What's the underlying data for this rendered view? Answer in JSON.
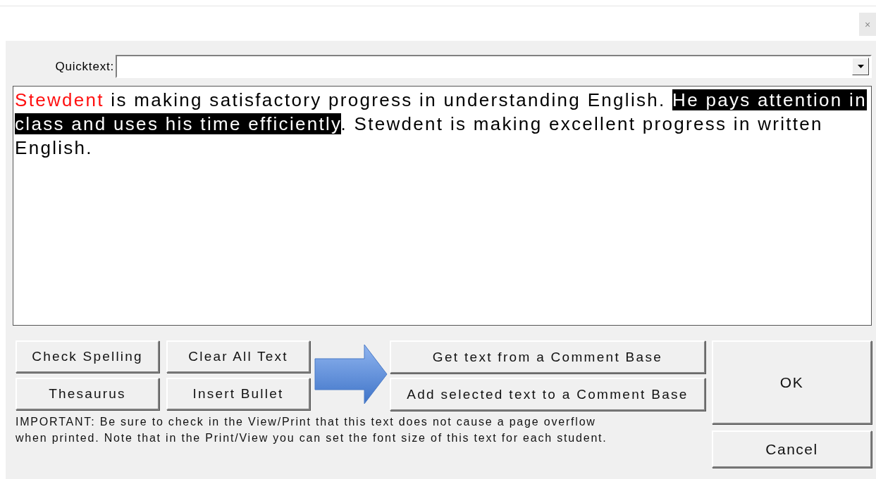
{
  "close_button": {
    "label": "×"
  },
  "quicktext": {
    "label": "Quicktext:"
  },
  "editor": {
    "segments": [
      {
        "kind": "highlight",
        "text": "Stewdent"
      },
      {
        "kind": "plain",
        "text": " is making satisfactory progress in understanding English. "
      },
      {
        "kind": "selected",
        "text": "He pays attention in class and uses his time efficiently"
      },
      {
        "kind": "plain",
        "text": ". Stewdent is making excellent progress in written English."
      }
    ]
  },
  "tool_buttons": [
    "Check Spelling",
    "Clear All Text",
    "Thesaurus",
    "Insert Bullet"
  ],
  "comment_buttons": [
    "Get text from a Comment Base",
    "Add selected text to a Comment Base"
  ],
  "note": [
    "IMPORTANT: Be sure to check in the View/Print that this text does not cause a page overflow",
    "when printed. Note that in the Print/View you can set the font size of this text for each student."
  ],
  "ok_button": "OK",
  "cancel_button": "Cancel"
}
